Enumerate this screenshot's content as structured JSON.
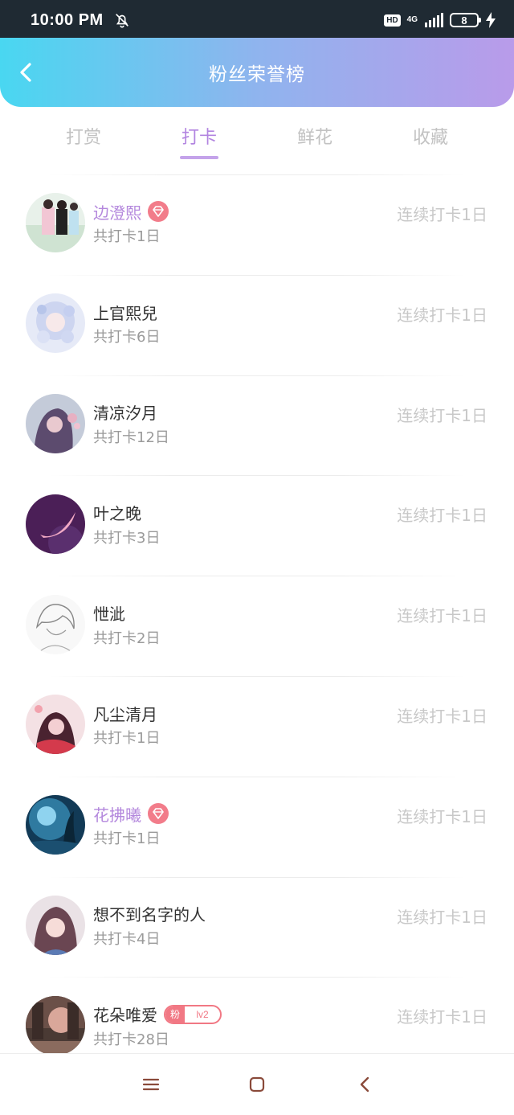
{
  "status_bar": {
    "time": "10:00 PM",
    "hd": "HD",
    "network": "4G",
    "battery": "8"
  },
  "header": {
    "title": "粉丝荣誉榜"
  },
  "tabs": [
    {
      "label": "打赏",
      "active": false
    },
    {
      "label": "打卡",
      "active": true
    },
    {
      "label": "鲜花",
      "active": false
    },
    {
      "label": "收藏",
      "active": false
    }
  ],
  "rows": [
    {
      "name": "边澄熙",
      "total": "共打卡1日",
      "streak": "连续打卡1日",
      "vip": true,
      "badge": "gem"
    },
    {
      "name": "上官熙兒",
      "total": "共打卡6日",
      "streak": "连续打卡1日",
      "vip": false,
      "badge": ""
    },
    {
      "name": "清凉汐月",
      "total": "共打卡12日",
      "streak": "连续打卡1日",
      "vip": false,
      "badge": ""
    },
    {
      "name": "叶之晚",
      "total": "共打卡3日",
      "streak": "连续打卡1日",
      "vip": false,
      "badge": ""
    },
    {
      "name": "怈泚",
      "total": "共打卡2日",
      "streak": "连续打卡1日",
      "vip": false,
      "badge": ""
    },
    {
      "name": "凡尘清月",
      "total": "共打卡1日",
      "streak": "连续打卡1日",
      "vip": false,
      "badge": ""
    },
    {
      "name": "花拂曦",
      "total": "共打卡1日",
      "streak": "连续打卡1日",
      "vip": true,
      "badge": "gem"
    },
    {
      "name": "想不到名字的人",
      "total": "共打卡4日",
      "streak": "连续打卡1日",
      "vip": false,
      "badge": ""
    },
    {
      "name": "花朵唯爱",
      "total": "共打卡28日",
      "streak": "连续打卡1日",
      "vip": false,
      "badge": "fan",
      "fan_label": "粉",
      "fan_level": "lv2"
    }
  ],
  "colors": {
    "header_gradient": [
      "#49d7f1",
      "#b99bea"
    ],
    "tab_active": "#b284e0",
    "vip_name": "#b488dd",
    "fan_badge": "#f17884"
  },
  "icons": {
    "back": "chevron-left-icon",
    "mute": "bell-off-icon",
    "gem": "diamond-icon",
    "nav_menu": "menu-icon",
    "nav_home": "square-icon",
    "nav_back": "chevron-left-icon"
  }
}
